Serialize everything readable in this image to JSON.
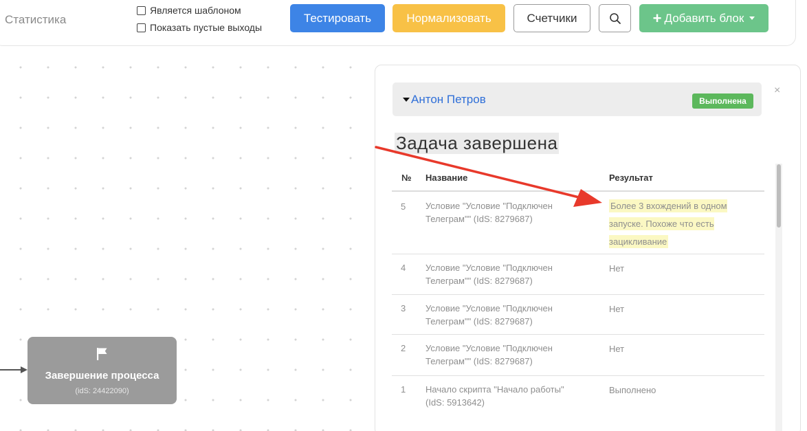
{
  "toolbar": {
    "statistics_label": "Статистика",
    "is_template_label": "Является шаблоном",
    "show_empty_outputs_label": "Показать пустые выходы",
    "test_label": "Тестировать",
    "normalize_label": "Нормализовать",
    "counters_label": "Счетчики",
    "add_block_label": "Добавить блок"
  },
  "node": {
    "title": "Завершение процесса",
    "id_text": "(idS: 24422090)"
  },
  "panel": {
    "close_symbol": "×",
    "user_name": "Антон Петров",
    "status_badge": "Выполнена",
    "task_title": "Задача завершена",
    "columns": {
      "number": "№",
      "name": "Название",
      "result": "Результат"
    },
    "rows": [
      {
        "number": "5",
        "name": "Условие \"Условие \"Подключен Телеграм\"\" (IdS: 8279687)",
        "result": "Более 3 вхождений в одном запуске. Похоже что есть зацикливание"
      },
      {
        "number": "4",
        "name": "Условие \"Условие \"Подключен Телеграм\"\" (IdS: 8279687)",
        "result": "Нет"
      },
      {
        "number": "3",
        "name": "Условие \"Условие \"Подключен Телеграм\"\" (IdS: 8279687)",
        "result": "Нет"
      },
      {
        "number": "2",
        "name": "Условие \"Условие \"Подключен Телеграм\"\" (IdS: 8279687)",
        "result": "Нет"
      },
      {
        "number": "1",
        "name": "Начало скрипта \"Начало работы\" (IdS: 5913642)",
        "result": "Выполнено"
      }
    ]
  },
  "colors": {
    "test_button": "#3d84e6",
    "normalize_button": "#f8c146",
    "add_block_button": "#6cc58a",
    "status_badge": "#5cb85c",
    "annotation_arrow": "#e8392b"
  }
}
